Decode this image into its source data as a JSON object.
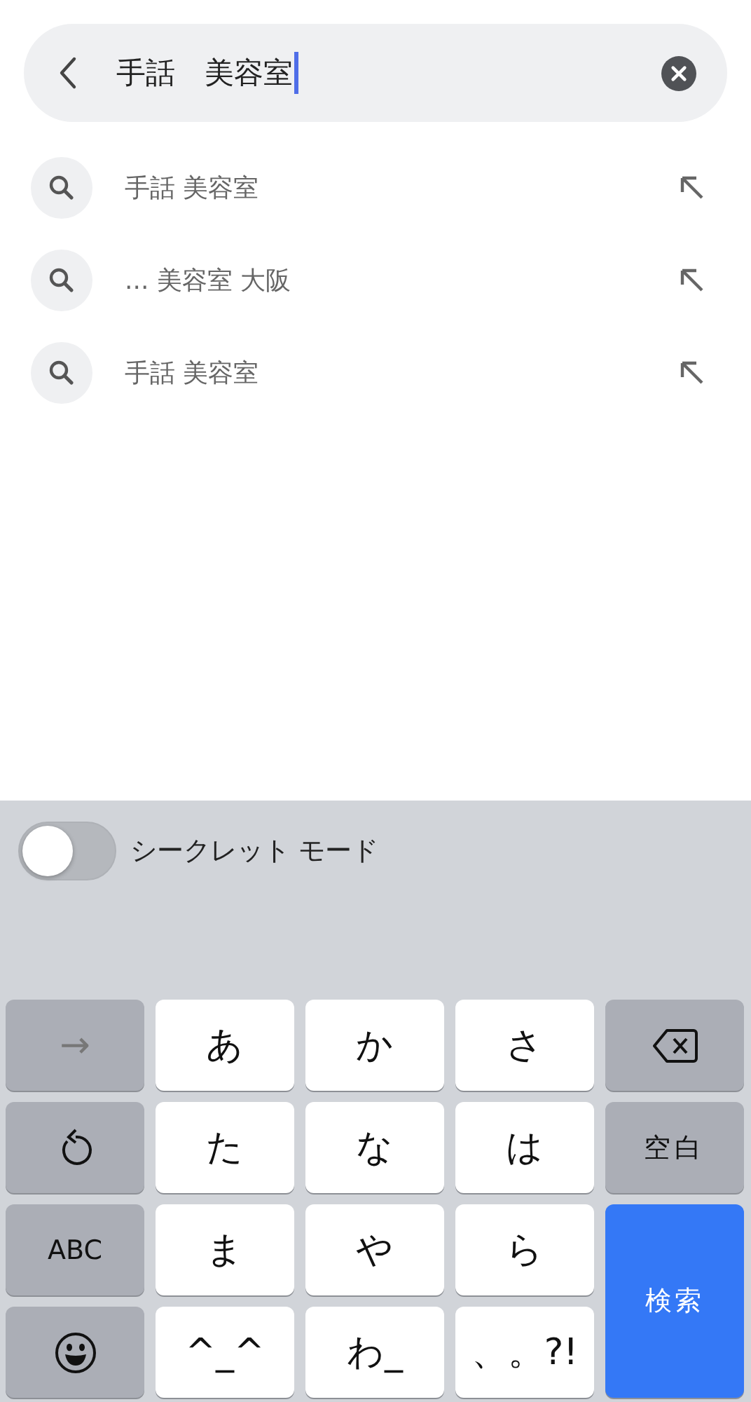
{
  "search": {
    "value": "手話　美容室"
  },
  "suggestions": [
    {
      "text": "手話 美容室"
    },
    {
      "text": "... 美容室 大阪"
    },
    {
      "text": "手話 美容室"
    }
  ],
  "keyboard": {
    "incognito": {
      "label": "シークレット モード",
      "on": false
    },
    "keys": [
      {
        "kind": "function",
        "label": "→"
      },
      {
        "kind": "char",
        "label": "あ"
      },
      {
        "kind": "char",
        "label": "か"
      },
      {
        "kind": "char",
        "label": "さ"
      },
      {
        "kind": "delete"
      },
      {
        "kind": "undo"
      },
      {
        "kind": "char",
        "label": "た"
      },
      {
        "kind": "char",
        "label": "な"
      },
      {
        "kind": "char",
        "label": "は"
      },
      {
        "kind": "function",
        "label": "空白"
      },
      {
        "kind": "function",
        "label": "ABC"
      },
      {
        "kind": "char",
        "label": "ま"
      },
      {
        "kind": "char",
        "label": "や"
      },
      {
        "kind": "char",
        "label": "ら"
      },
      {
        "kind": "action",
        "label": "検索"
      },
      {
        "kind": "emoji"
      },
      {
        "kind": "char",
        "label": "^_^"
      },
      {
        "kind": "char",
        "label": "わ_"
      },
      {
        "kind": "char",
        "label": "、。?!"
      }
    ]
  }
}
